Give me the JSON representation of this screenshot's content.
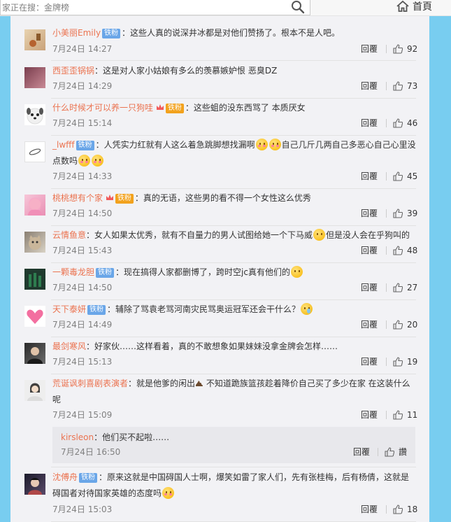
{
  "search": {
    "value": "家正在搜：金牌榜"
  },
  "nav": {
    "home_label": "首頁"
  },
  "reply_label": "回覆",
  "comments": [
    {
      "user": "小美丽Emily",
      "badge": "铁粉",
      "badge_style": "blue",
      "text": "：这些人真的说深井冰都是对他们赞扬了。根本不是人吧。",
      "time": "7月24日 14:27",
      "likes": "92"
    },
    {
      "user": "西歪歪锅锅",
      "text": "：这是对人家小姑娘有多么的羡慕嫉妒恨 恶臭DZ",
      "time": "7月24日 14:29",
      "likes": "73"
    },
    {
      "user": "什么时候才可以养一只狗哇",
      "badge": "铁粉",
      "badge_style": "gold",
      "text": "：这些蛆的没东西骂了 本质厌女",
      "time": "7月24日 15:14",
      "likes": "46"
    },
    {
      "user": "_lwfff",
      "badge": "铁粉",
      "badge_style": "blue",
      "text_a": "：人凭实力红就有人这么着急跳脚想找漏啊",
      "text_b": "自己几斤几两自己多恶心自己心里没点数吗",
      "time": "7月24日 14:33",
      "likes": "45"
    },
    {
      "user": "桃桃想有个家",
      "badge": "铁粉",
      "badge_style": "gold",
      "text": "：真的无语，这些男的看不得一个女性这么优秀",
      "time": "7月24日 14:50",
      "likes": "39"
    },
    {
      "user": "云情鱼意",
      "text_a": "：女人如果太优秀，就有不自量力的男人试图给她一个下马威",
      "text_b": "但是没人会在乎狗叫的",
      "time": "7月24日 15:43",
      "likes": "48"
    },
    {
      "user": "一颗毒龙胆",
      "badge": "铁粉",
      "badge_style": "blue",
      "text": "：现在搞得人家都删博了，跨时空jc真有他们的",
      "time": "7月24日 14:50",
      "likes": "27"
    },
    {
      "user": "天下泰妍",
      "badge": "铁粉",
      "badge_style": "blue",
      "text": "：辅除了骂袁老骂河南灾民骂奥运冠军还会干什么？",
      "time": "7月24日 14:49",
      "likes": "20"
    },
    {
      "user": "最剑寒风",
      "text": "：好家伙……这样看着，真的不敢想象如果妹妹没拿金牌会怎样……",
      "time": "7月24日 15:13",
      "likes": "19"
    },
    {
      "user": "荒诞讽刺喜剧表演者",
      "text_a": "：就是他爹的闲出",
      "text_b": " 不知道跪族篮孩趁着降价自己买了多少在家 在这装什么呢",
      "time": "7月24日 15:09",
      "likes": "11"
    },
    {
      "user": "沈傅舟",
      "badge": "铁粉",
      "badge_style": "blue",
      "text": "：原来这就是中国碍国人士啊，爆笑如雷了家人们，先有张桂梅，后有杨倩，这就是碍国者对待国家英雄的态度吗",
      "time": "7月24日 15:03",
      "likes": "18"
    }
  ],
  "subreply": {
    "user": "kirsleon",
    "text": "：他们买不起啦……",
    "time": "7月24日 16:50",
    "likes": "讚"
  },
  "colors": {
    "username": "#eb7350",
    "badge_blue": "#6aa6e8",
    "badge_gold": "#f2a21d",
    "page_bg": "#78cdf0",
    "card_bg": "#f2f2f5"
  }
}
